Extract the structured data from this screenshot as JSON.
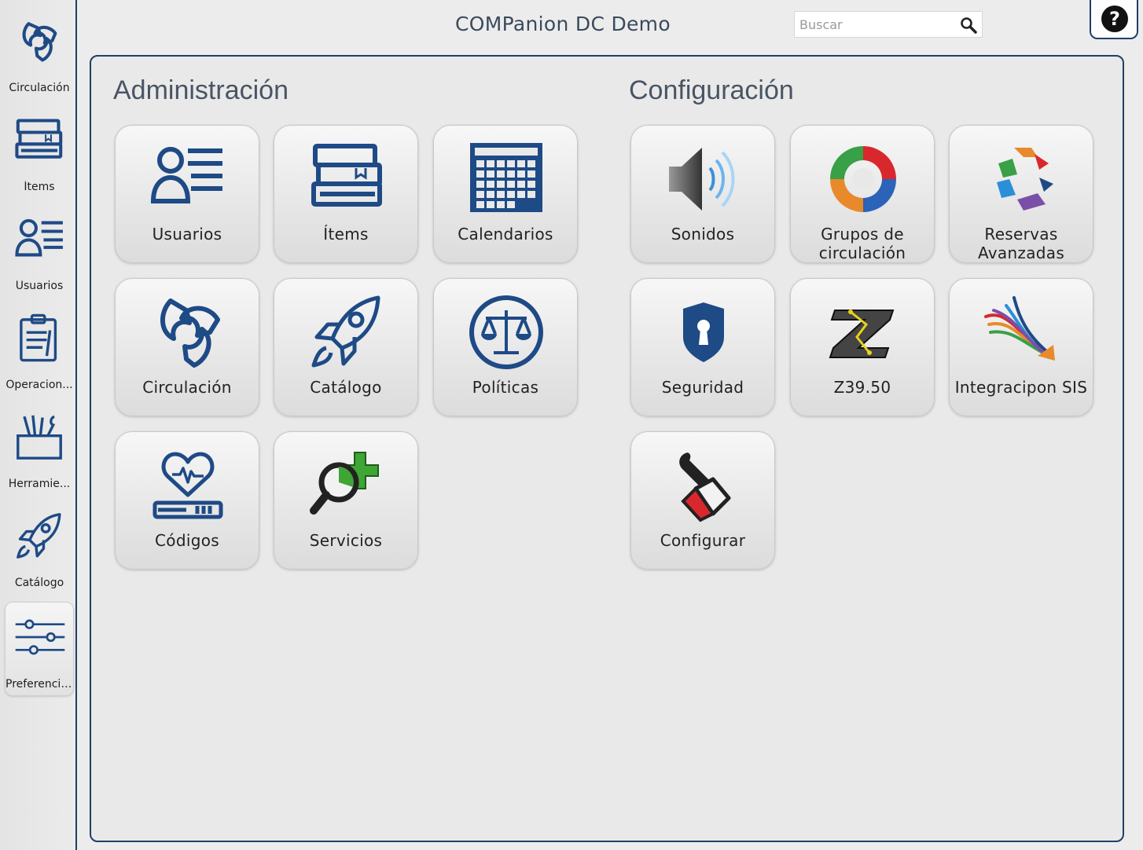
{
  "app": {
    "title": "COMPanion DC Demo"
  },
  "search": {
    "placeholder": "Buscar"
  },
  "help": {
    "label": "?"
  },
  "sidebar": {
    "items": [
      {
        "label": "Circulación",
        "icon": "circulation-icon"
      },
      {
        "label": "Ítems",
        "icon": "books-icon"
      },
      {
        "label": "Usuarios",
        "icon": "users-icon"
      },
      {
        "label": "Operacion...",
        "icon": "clipboard-icon"
      },
      {
        "label": "Herramie...",
        "icon": "tools-icon"
      },
      {
        "label": "Catálogo",
        "icon": "rocket-icon"
      },
      {
        "label": "Preferencias",
        "icon": "sliders-icon",
        "active": true
      }
    ]
  },
  "administracion": {
    "title": "Administración",
    "tiles": [
      {
        "label": "Usuarios",
        "icon": "users-icon"
      },
      {
        "label": "Ítems",
        "icon": "books-icon"
      },
      {
        "label": "Calendarios",
        "icon": "calendar-icon"
      },
      {
        "label": "Circulación",
        "icon": "circulation-icon"
      },
      {
        "label": "Catálogo",
        "icon": "rocket-icon"
      },
      {
        "label": "Políticas",
        "icon": "scales-icon"
      },
      {
        "label": "Códigos",
        "icon": "heart-barcode-icon"
      },
      {
        "label": "Servicios",
        "icon": "magnifier-plus-icon"
      }
    ]
  },
  "configuracion": {
    "title": "Configuración",
    "tiles": [
      {
        "label": "Sonidos",
        "icon": "speaker-icon"
      },
      {
        "label_line1": "Grupos de",
        "label_line2": "circulación",
        "icon": "circulation-groups-icon"
      },
      {
        "label_line1": "Reservas",
        "label_line2": "Avanzadas",
        "icon": "advanced-reserves-icon"
      },
      {
        "label": "Seguridad",
        "icon": "shield-lock-icon"
      },
      {
        "label": "Z39.50",
        "icon": "z3950-icon"
      },
      {
        "label": "Integracipon SIS",
        "icon": "sis-integration-icon"
      },
      {
        "label": "Configurar",
        "icon": "wrench-hand-icon"
      }
    ]
  },
  "colors": {
    "navy": "#1f3f66",
    "icon_blue": "#1e4a86",
    "panel_border": "#1f3f66"
  }
}
